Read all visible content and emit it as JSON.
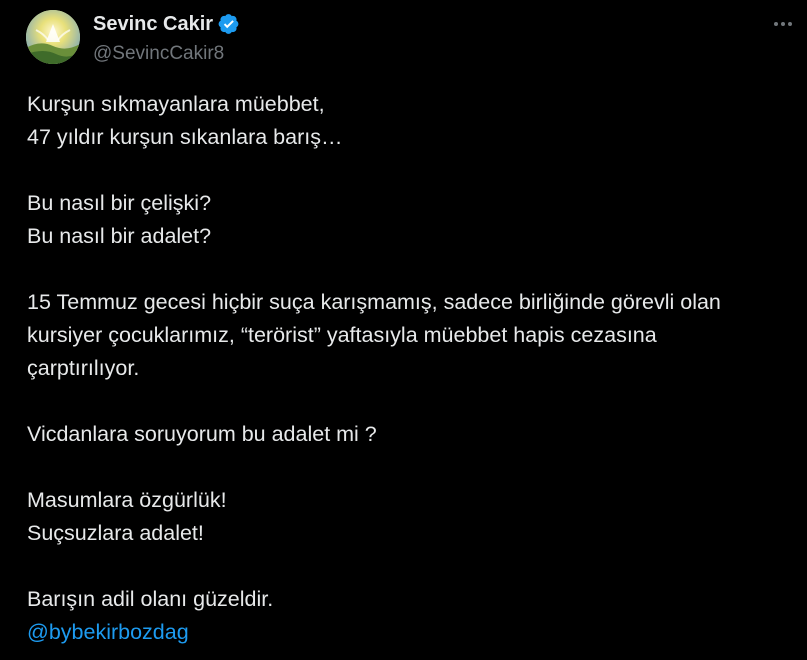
{
  "author": {
    "display_name": "Sevinc Cakir",
    "handle": "@SevincCakir8",
    "verified_icon": "verified-badge-icon",
    "avatar_icon": "avatar-image"
  },
  "menu": {
    "more_icon": "more-dots-icon"
  },
  "colors": {
    "background": "#000000",
    "text": "#e7e9ea",
    "secondary_text": "#71767b",
    "accent": "#1d9bf0"
  },
  "tweet": {
    "paragraphs": [
      [
        "Kurşun sıkmayanlara müebbet,",
        "47 yıldır kurşun sıkanlara barış…"
      ],
      [
        "Bu nasıl bir çelişki?",
        "Bu nasıl bir adalet?"
      ],
      [
        "15 Temmuz gecesi hiçbir suça karışmamış, sadece birliğinde görevli olan",
        "kursiyer çocuklarımız, “terörist” yaftasıyla müebbet hapis cezasına",
        "çarptırılıyor."
      ],
      [
        "Vicdanlara soruyorum bu adalet mi ?"
      ],
      [
        "Masumlara özgürlük!",
        "Suçsuzlara adalet!"
      ],
      [
        "Barışın adil olanı güzeldir."
      ]
    ],
    "mention": "@bybekirbozdag"
  }
}
